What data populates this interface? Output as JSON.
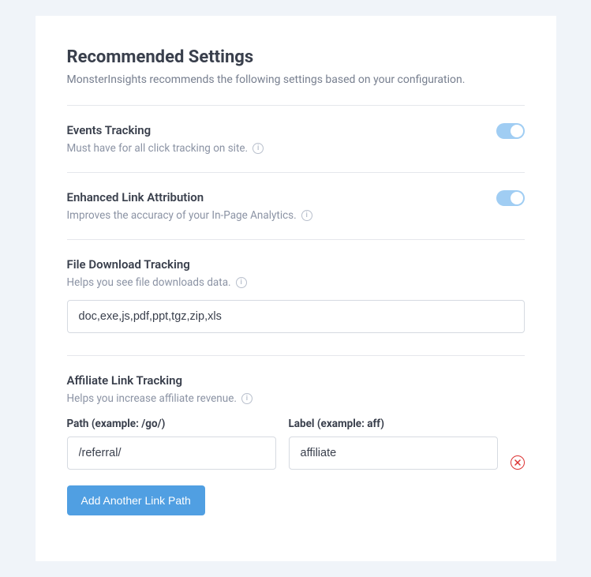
{
  "header": {
    "title": "Recommended Settings",
    "subtitle": "MonsterInsights recommends the following settings based on your configuration."
  },
  "settings": {
    "events_tracking": {
      "title": "Events Tracking",
      "desc": "Must have for all click tracking on site.",
      "enabled": true
    },
    "enhanced_link": {
      "title": "Enhanced Link Attribution",
      "desc": "Improves the accuracy of your In-Page Analytics.",
      "enabled": true
    },
    "file_download": {
      "title": "File Download Tracking",
      "desc": "Helps you see file downloads data.",
      "value": "doc,exe,js,pdf,ppt,tgz,zip,xls"
    },
    "affiliate": {
      "title": "Affiliate Link Tracking",
      "desc": "Helps you increase affiliate revenue.",
      "path_label": "Path (example: /go/)",
      "label_label": "Label (example: aff)",
      "rows": [
        {
          "path": "/referral/",
          "label": "affiliate"
        }
      ],
      "add_button": "Add Another Link Path"
    }
  }
}
